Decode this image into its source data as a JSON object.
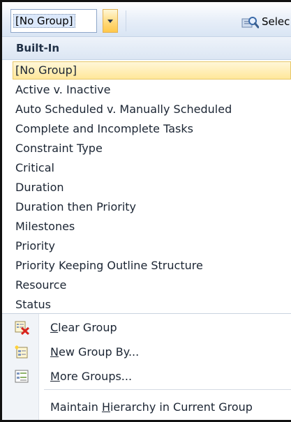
{
  "toolbar": {
    "group_value": "[No Group]",
    "select_label": "Selec",
    "dropdown_icon": "chevron-down-icon",
    "select_icon": "magnifier-icon"
  },
  "menu": {
    "section_header": "Built-In",
    "items": [
      "[No Group]",
      "Active v. Inactive",
      "Auto Scheduled v. Manually Scheduled",
      "Complete and Incomplete Tasks",
      "Constraint Type",
      "Critical",
      "Duration",
      "Duration then Priority",
      "Milestones",
      "Priority",
      "Priority Keeping Outline Structure",
      "Resource",
      "Status"
    ],
    "selected_index": 0
  },
  "commands": {
    "clear_group": {
      "accel": "C",
      "rest": "lear Group",
      "icon": "clear-group-icon"
    },
    "new_group_by": {
      "accel": "N",
      "rest": "ew Group By...",
      "icon": "new-group-icon"
    },
    "more_groups": {
      "accel": "M",
      "rest": "ore Groups...",
      "icon": "more-groups-icon"
    },
    "maintain_hierarchy": {
      "before": "Maintain ",
      "accel": "H",
      "after": "ierarchy in Current Group"
    }
  },
  "colors": {
    "selected_highlight": "#ffe79a",
    "header_bg": "#dce6f3",
    "ribbon_bg": "#d9e5f4"
  }
}
